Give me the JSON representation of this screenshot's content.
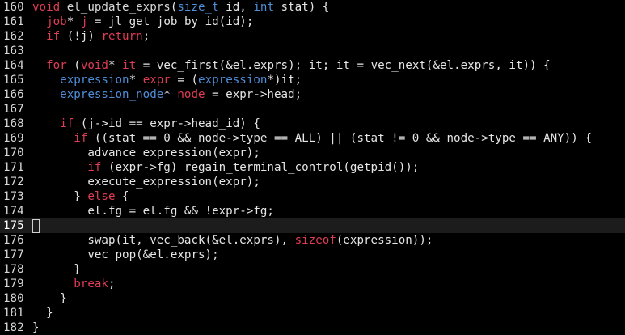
{
  "editor": {
    "cursor_line": "175",
    "colors": {
      "background": "#000000",
      "keyword": "#e03c54",
      "type": "#4f8ed8",
      "text": "#e5e5e5",
      "line_number": "#d6d6d6",
      "current_line_highlight": "#1c1c1c"
    },
    "lines": [
      {
        "num": "160",
        "tokens": [
          [
            "kw",
            "void"
          ],
          [
            "t",
            " "
          ],
          [
            "fn",
            "el_update_exprs"
          ],
          [
            "t",
            "("
          ],
          [
            "ty",
            "size_t"
          ],
          [
            "t",
            " id, "
          ],
          [
            "ty",
            "int"
          ],
          [
            "t",
            " stat) {"
          ]
        ]
      },
      {
        "num": "161",
        "tokens": [
          [
            "t",
            "  "
          ],
          [
            "kw",
            "job"
          ],
          [
            "t",
            "* "
          ],
          [
            "kw",
            "j"
          ],
          [
            "t",
            " = jl_get_job_by_id(id);"
          ]
        ]
      },
      {
        "num": "162",
        "tokens": [
          [
            "t",
            "  "
          ],
          [
            "kw",
            "if"
          ],
          [
            "t",
            " (!j) "
          ],
          [
            "kw",
            "return"
          ],
          [
            "t",
            ";"
          ]
        ]
      },
      {
        "num": "163",
        "tokens": []
      },
      {
        "num": "164",
        "tokens": [
          [
            "t",
            "  "
          ],
          [
            "kw",
            "for"
          ],
          [
            "t",
            " ("
          ],
          [
            "kw",
            "void"
          ],
          [
            "t",
            "* "
          ],
          [
            "kw",
            "it"
          ],
          [
            "t",
            " = vec_first(&el.exprs); it; it = vec_next(&el.exprs, it)) {"
          ]
        ]
      },
      {
        "num": "165",
        "tokens": [
          [
            "t",
            "    "
          ],
          [
            "ty",
            "expression"
          ],
          [
            "t",
            "* "
          ],
          [
            "kw",
            "expr"
          ],
          [
            "t",
            " = ("
          ],
          [
            "ty",
            "expression"
          ],
          [
            "t",
            "*)it;"
          ]
        ]
      },
      {
        "num": "166",
        "tokens": [
          [
            "t",
            "    "
          ],
          [
            "ty",
            "expression_node"
          ],
          [
            "t",
            "* "
          ],
          [
            "kw",
            "node"
          ],
          [
            "t",
            " = expr->head;"
          ]
        ]
      },
      {
        "num": "167",
        "tokens": []
      },
      {
        "num": "168",
        "tokens": [
          [
            "t",
            "    "
          ],
          [
            "kw",
            "if"
          ],
          [
            "t",
            " (j->id == expr->head_id) {"
          ]
        ]
      },
      {
        "num": "169",
        "tokens": [
          [
            "t",
            "      "
          ],
          [
            "kw",
            "if"
          ],
          [
            "t",
            " ((stat == 0 && node->type == ALL) || (stat != 0 && node->type == ANY)) {"
          ]
        ]
      },
      {
        "num": "170",
        "tokens": [
          [
            "t",
            "        advance_expression(expr);"
          ]
        ]
      },
      {
        "num": "171",
        "tokens": [
          [
            "t",
            "        "
          ],
          [
            "kw",
            "if"
          ],
          [
            "t",
            " (expr->fg) regain_terminal_control(getpid());"
          ]
        ]
      },
      {
        "num": "172",
        "tokens": [
          [
            "t",
            "        execute_expression(expr);"
          ]
        ]
      },
      {
        "num": "173",
        "tokens": [
          [
            "t",
            "      } "
          ],
          [
            "kw",
            "else"
          ],
          [
            "t",
            " {"
          ]
        ]
      },
      {
        "num": "174",
        "tokens": [
          [
            "t",
            "        el.fg = el.fg && !expr->fg;"
          ]
        ]
      },
      {
        "num": "175",
        "tokens": [],
        "current": true
      },
      {
        "num": "176",
        "tokens": [
          [
            "t",
            "        swap(it, vec_back(&el.exprs), "
          ],
          [
            "kw",
            "sizeof"
          ],
          [
            "t",
            "(expression));"
          ]
        ]
      },
      {
        "num": "177",
        "tokens": [
          [
            "t",
            "        vec_pop(&el.exprs);"
          ]
        ]
      },
      {
        "num": "178",
        "tokens": [
          [
            "t",
            "      }"
          ]
        ]
      },
      {
        "num": "179",
        "tokens": [
          [
            "t",
            "      "
          ],
          [
            "kw",
            "break"
          ],
          [
            "t",
            ";"
          ]
        ]
      },
      {
        "num": "180",
        "tokens": [
          [
            "t",
            "    }"
          ]
        ]
      },
      {
        "num": "181",
        "tokens": [
          [
            "t",
            "  }"
          ]
        ]
      },
      {
        "num": "182",
        "tokens": [
          [
            "t",
            "}"
          ]
        ]
      }
    ]
  }
}
